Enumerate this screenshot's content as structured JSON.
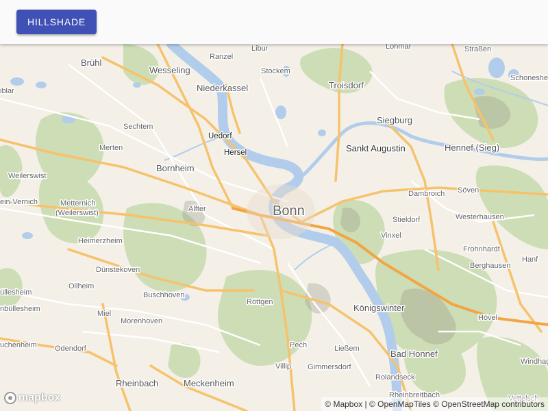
{
  "toolbar": {
    "button_label": "HILLSHADE"
  },
  "colors": {
    "appbar_bg": "#fafafa",
    "button_bg": "#3f51b5",
    "button_text": "#ffffff",
    "water": "#b2cdeb",
    "land": "#f4f0e8",
    "forest": "#c9dcb0",
    "major_road": "#f6c26b",
    "minor_road": "#ffffff"
  },
  "map": {
    "places": {
      "bonn": "Bonn",
      "sankt_augustin": "Sankt Augustin",
      "siegburg": "Siegburg",
      "troisdorf": "Troisdorf",
      "niederkassel": "Niederkassel",
      "wesseling": "Wesseling",
      "bruhl": "Brühl",
      "bornheim": "Bornheim",
      "uedorf": "Uedorf",
      "hersel": "Hersel",
      "sechtem": "Sechtem",
      "merten": "Merten",
      "alfter": "Alfter",
      "weilerswist": "Weilerswist",
      "metternich": "Metternich",
      "metternich_sub": "(Weilerswist)",
      "heimerzheim": "Heimerzheim",
      "dunstekoven": "Dünstekoven",
      "olheim": "Ollheim",
      "buschhoven": "Buschhoven",
      "rottgen": "Röttgen",
      "morenhoven": "Morenhoven",
      "miel": "Miel",
      "odendorf": "Odendorf",
      "rheinbach": "Rheinbach",
      "meckenheim": "Meckenheim",
      "pech": "Pech",
      "liessem": "Ließem",
      "villip": "Villip",
      "gimmersdorf": "Gimmersdorf",
      "konigswinter": "Königswinter",
      "bad_honnef": "Bad Honnef",
      "rolandseck": "Rolandseck",
      "rheinbreitbach": "Rheinbreitbach",
      "vinxel": "Vinxel",
      "stieldorf": "Stieldorf",
      "dambroich": "Dambroich",
      "soven": "Söven",
      "westerhausen": "Westerhausen",
      "frohnhardt": "Frohnhardt",
      "berghausen": "Berghausen",
      "hanf": "Hanf",
      "hovel": "Hövel",
      "windhagen": "Windhage",
      "hennef": "Hennef (Sieg)",
      "lohmar": "Lohmar",
      "strassen": "Straßen",
      "schoneshof": "Schoneshe",
      "ranzel": "Ranzel",
      "libur": "Libur",
      "stockem": "Stockem",
      "liblar": "iblar",
      "vernich": "ein-Vernich",
      "bulles1": "üllesheim",
      "bulles2": "nbüllesheim",
      "lechen": "uchenheim",
      "vettelsch": "Vettelsch"
    }
  },
  "logo": {
    "text": "mapbox"
  },
  "attribution": {
    "mapbox": "© Mapbox",
    "separator": "|",
    "openmaptiles": "© OpenMapTiles",
    "osm": "© OpenStreetMap contributors"
  }
}
